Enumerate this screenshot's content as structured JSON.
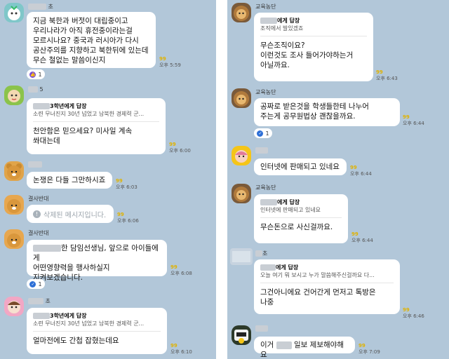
{
  "left": [
    {
      "name": "초",
      "text": "지금 북한과 버젓이 대립중이고\n우리나라가 아직 휴전중이라는걸\n모르시나요? 중국과 러시아가 다시\n공산주의를 지향하고 북한뒤에 있는데\n무슨 철없는 말씀이신지",
      "count": "99",
      "time": "오후 5:59",
      "reaction": "1"
    },
    {
      "name": "5",
      "reply_to": "3학년에게 답장",
      "reply_preview": "소련 무너진지 30년 넘었고 남북한 경제력 군...",
      "text": "천안함은 믿으세요? 미사일 계속\n쏴대는데",
      "count": "99",
      "time": "오후 6:00"
    },
    {
      "name": "",
      "text": "논쟁은 다들 그만하시죠",
      "count": "99",
      "time": "오후 6:03"
    },
    {
      "name": "결사반대",
      "text": "삭제된 메시지입니다.",
      "count": "99",
      "time": "오후 6:06"
    },
    {
      "name": "결사반대",
      "text_line1": "한 담임선생님, 앞으로 아이들에게",
      "text": "어떤영향력을 행사하실지\n지켜보겠습니다.",
      "count": "99",
      "time": "오후 6:08",
      "reaction": "1"
    },
    {
      "name": "초",
      "reply_to": "3학년에게 답장",
      "reply_preview": "소련 무너진지 30년 넘었고 남북한 경제력 군...",
      "text": "얼마전에도 간첩 잡혔는데요",
      "count": "99",
      "time": "오후 6:10"
    }
  ],
  "right": [
    {
      "name": "교육농단",
      "reply_to": "에게 답장",
      "reply_preview": "조직에서 발있겠죠",
      "text": "무슨조직이요?\n이런것도 조사 들어가야하는거\n아닐까요.",
      "count": "99",
      "time": "오후 6:43"
    },
    {
      "name": "교육농단",
      "text": "공짜로 받은것을 학생들한테 나누어\n주는게 공무원법상 괜찮을까요.",
      "count": "99",
      "time": "오후 6:44",
      "reaction": "1"
    },
    {
      "name": "",
      "text": "인터넷에 판매되고 있네요",
      "count": "99",
      "time": "오후 6:44"
    },
    {
      "name": "교육농단",
      "reply_to": "에게 답장",
      "reply_preview": "인터넷에 판매되고 있네요",
      "text": "무슨돈으로 사신걸까요.",
      "count": "99",
      "time": "오후 6:44"
    },
    {
      "name": "초",
      "reply_to": "에게 답장",
      "reply_preview": "오늘 여기 뭐 보시고 누가 말씀해주신걸까요 다...",
      "text": "그건아니에요 건어간게 먼저고 톡방은\n나중",
      "count": "99",
      "time": "오후 6:46"
    },
    {
      "name": "",
      "text_prefix": "이거",
      "text_suffix": "일보 제보해야해요",
      "count": "99",
      "time": "오후 7:09"
    }
  ],
  "colors": {
    "background": "#b2c7d9",
    "bubble": "#ffffff",
    "unread": "#e0b200",
    "thumb": "#7a4fd6",
    "check": "#2d6fd6"
  }
}
